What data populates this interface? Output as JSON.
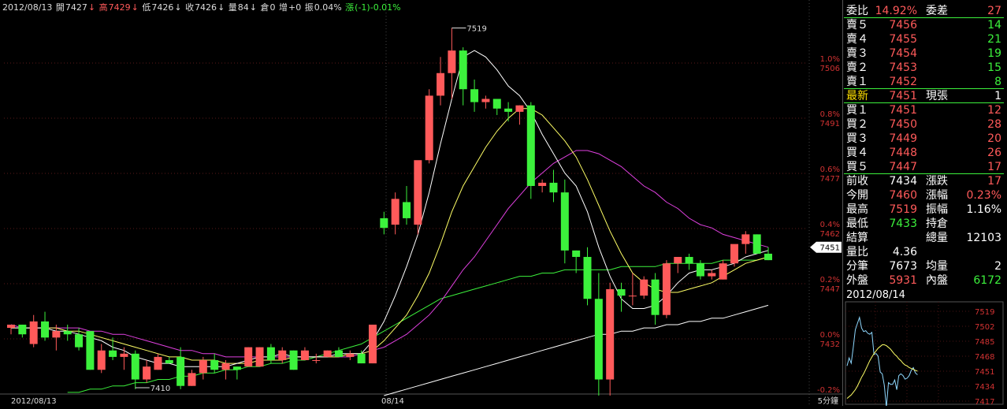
{
  "header": {
    "date": "2012/08/13",
    "open_label": "開",
    "open": "7427",
    "high_label": "高",
    "high": "7429",
    "low_label": "低",
    "low": "7426",
    "close_label": "收",
    "close": "7426",
    "vol_label": "量",
    "vol": "84",
    "oi_label": "倉",
    "oi": "0",
    "add_label": "增",
    "add": "+0",
    "amp_label": "振",
    "amp": "0.04%",
    "chg_label": "漲",
    "chg": "(-1)-0.01%",
    "arrow_down": "↓"
  },
  "chart_data": {
    "type": "candlestick",
    "y_left_labels": [
      "1.0%",
      "0.8%",
      "0.6%",
      "0.4%",
      "0.2%",
      "0.0%",
      "-0.2%"
    ],
    "y_right_labels": [
      "7506",
      "7491",
      "7477",
      "7462",
      "7447",
      "7432"
    ],
    "ylim": [
      7416,
      7530
    ],
    "x_labels": [
      "2012/08/13",
      "08/14"
    ],
    "period_label": "5分鐘",
    "current_price_tag": "7451",
    "high_mark": "7519",
    "low_mark": "7410",
    "colors": {
      "up": "#ff5a5a",
      "down": "#3cf13c",
      "ma5": "#ffffff",
      "ma10": "#ffff66",
      "ma20": "#e040e0",
      "ma60": "#3cf13c",
      "ma120": "#ffffff"
    },
    "candles": [
      [
        7426,
        7427,
        7424,
        7427
      ],
      [
        7427,
        7427,
        7423,
        7424
      ],
      [
        7421,
        7430,
        7420,
        7428
      ],
      [
        7428,
        7431,
        7422,
        7423
      ],
      [
        7423,
        7427,
        7419,
        7425
      ],
      [
        7425,
        7427,
        7422,
        7424
      ],
      [
        7424,
        7426,
        7419,
        7420
      ],
      [
        7425,
        7425,
        7413,
        7413
      ],
      [
        7413,
        7421,
        7412,
        7419
      ],
      [
        7419,
        7423,
        7416,
        7417
      ],
      [
        7417,
        7420,
        7413,
        7418
      ],
      [
        7418,
        7419,
        7407,
        7410
      ],
      [
        7410,
        7416,
        7409,
        7414
      ],
      [
        7413,
        7418,
        7413,
        7417
      ],
      [
        7416,
        7417,
        7415,
        7415
      ],
      [
        7417,
        7420,
        7407,
        7408
      ],
      [
        7408,
        7413,
        7408,
        7412
      ],
      [
        7412,
        7417,
        7410,
        7416
      ],
      [
        7416,
        7418,
        7412,
        7413
      ],
      [
        7413,
        7416,
        7410,
        7415
      ],
      [
        7414,
        7414,
        7410,
        7413
      ],
      [
        7414,
        7420,
        7414,
        7420
      ],
      [
        7414,
        7420,
        7414,
        7420
      ],
      [
        7420,
        7421,
        7415,
        7416
      ],
      [
        7416,
        7420,
        7415,
        7419
      ],
      [
        7419,
        7419,
        7413,
        7413
      ],
      [
        7416,
        7420,
        7416,
        7419
      ],
      [
        7416,
        7418,
        7415,
        7416
      ],
      [
        7417,
        7419,
        7417,
        7419
      ],
      [
        7419,
        7420,
        7417,
        7417
      ],
      [
        7417,
        7419,
        7416,
        7418
      ],
      [
        7418,
        7419,
        7415,
        7415
      ],
      [
        7415,
        7427,
        7415,
        7427
      ],
      [
        7460,
        7462,
        7455,
        7457
      ],
      [
        7458,
        7468,
        7455,
        7466
      ],
      [
        7465,
        7470,
        7458,
        7460
      ],
      [
        7458,
        7475,
        7455,
        7478
      ],
      [
        7478,
        7500,
        7477,
        7498
      ],
      [
        7498,
        7510,
        7495,
        7505
      ],
      [
        7505,
        7519,
        7497,
        7512
      ],
      [
        7512,
        7513,
        7495,
        7500
      ],
      [
        7500,
        7503,
        7493,
        7496
      ],
      [
        7496,
        7498,
        7494,
        7497
      ],
      [
        7497,
        7497,
        7492,
        7494
      ],
      [
        7494,
        7496,
        7490,
        7493
      ],
      [
        7493,
        7495,
        7489,
        7495
      ],
      [
        7495,
        7496,
        7466,
        7470
      ],
      [
        7470,
        7472,
        7468,
        7471
      ],
      [
        7471,
        7475,
        7465,
        7468
      ],
      [
        7468,
        7472,
        7446,
        7450
      ],
      [
        7450,
        7450,
        7443,
        7448
      ],
      [
        7448,
        7451,
        7433,
        7435
      ],
      [
        7435,
        7443,
        7405,
        7410
      ],
      [
        7410,
        7440,
        7405,
        7438
      ],
      [
        7438,
        7440,
        7431,
        7436
      ],
      [
        7436,
        7443,
        7433,
        7436
      ],
      [
        7436,
        7442,
        7435,
        7441
      ],
      [
        7441,
        7443,
        7427,
        7430
      ],
      [
        7430,
        7447,
        7429,
        7446
      ],
      [
        7446,
        7448,
        7443,
        7448
      ],
      [
        7448,
        7449,
        7444,
        7446
      ],
      [
        7446,
        7447,
        7441,
        7442
      ],
      [
        7442,
        7444,
        7441,
        7443
      ],
      [
        7441,
        7447,
        7441,
        7446
      ],
      [
        7446,
        7451,
        7445,
        7452
      ],
      [
        7452,
        7456,
        7449,
        7455
      ],
      [
        7455,
        7455,
        7452,
        7449
      ],
      [
        7449,
        7451,
        7447,
        7447
      ]
    ],
    "ma5": [
      7426,
      7426,
      7426,
      7426,
      7425,
      7425,
      7424,
      7423,
      7422,
      7420,
      7419,
      7417,
      7416,
      7415,
      7415,
      7414,
      7414,
      7414,
      7414,
      7414,
      7415,
      7416,
      7417,
      7417,
      7418,
      7417,
      7417,
      7417,
      7417,
      7418,
      7418,
      7418,
      7422,
      7428,
      7436,
      7445,
      7455,
      7468,
      7483,
      7497,
      7510,
      7512,
      7510,
      7506,
      7501,
      7498,
      7493,
      7486,
      7480,
      7474,
      7470,
      7462,
      7451,
      7442,
      7435,
      7432,
      7432,
      7433,
      7436,
      7440,
      7443,
      7444,
      7444,
      7445,
      7446,
      7448,
      7449,
      7450
    ],
    "ma10": [
      7426,
      7426,
      7426,
      7426,
      7426,
      7425,
      7425,
      7424,
      7423,
      7422,
      7421,
      7420,
      7419,
      7418,
      7417,
      7417,
      7416,
      7416,
      7416,
      7415,
      7415,
      7415,
      7416,
      7416,
      7416,
      7417,
      7417,
      7417,
      7417,
      7417,
      7418,
      7418,
      7419,
      7422,
      7426,
      7430,
      7436,
      7443,
      7452,
      7462,
      7470,
      7476,
      7482,
      7487,
      7491,
      7494,
      7494,
      7492,
      7488,
      7484,
      7479,
      7472,
      7464,
      7456,
      7449,
      7443,
      7440,
      7438,
      7437,
      7437,
      7438,
      7439,
      7440,
      7442,
      7444,
      7446,
      7447,
      7448
    ],
    "ma20": [
      7427,
      7426,
      7426,
      7426,
      7426,
      7426,
      7426,
      7425,
      7425,
      7424,
      7424,
      7423,
      7422,
      7421,
      7420,
      7419,
      7419,
      7418,
      7418,
      7417,
      7417,
      7417,
      7417,
      7417,
      7417,
      7417,
      7417,
      7417,
      7417,
      7417,
      7417,
      7418,
      7419,
      7420,
      7422,
      7424,
      7427,
      7430,
      7434,
      7439,
      7444,
      7448,
      7453,
      7458,
      7463,
      7467,
      7471,
      7474,
      7477,
      7479,
      7481,
      7481,
      7480,
      7478,
      7476,
      7473,
      7470,
      7468,
      7465,
      7463,
      7460,
      7458,
      7457,
      7455,
      7454,
      7453,
      7452,
      7451
    ],
    "ma60": [
      null,
      null,
      null,
      null,
      null,
      7406,
      7406,
      7407,
      7407,
      7408,
      7408,
      7409,
      7409,
      7410,
      7410,
      7411,
      7411,
      7412,
      7412,
      7413,
      7413,
      7414,
      7414,
      7415,
      7415,
      7416,
      7416,
      7417,
      7418,
      7419,
      7420,
      7421,
      7423,
      7425,
      7427,
      7429,
      7431,
      7433,
      7435,
      7436,
      7437,
      7438,
      7439,
      7440,
      7441,
      7442,
      7442,
      7443,
      7443,
      7444,
      7444,
      7444,
      7444,
      7444,
      7445,
      7445,
      7445,
      7445,
      7446,
      7446,
      7446,
      7446,
      7446,
      7447,
      7447,
      7447,
      7447,
      7448
    ],
    "ma120": [
      null,
      null,
      null,
      null,
      null,
      null,
      null,
      null,
      null,
      null,
      null,
      null,
      null,
      null,
      null,
      null,
      null,
      null,
      null,
      null,
      null,
      null,
      null,
      null,
      null,
      null,
      null,
      null,
      null,
      null,
      null,
      null,
      null,
      7405,
      7406,
      7407,
      7408,
      7409,
      7410,
      7411,
      7412,
      7413,
      7414,
      7415,
      7416,
      7417,
      7418,
      7419,
      7420,
      7421,
      7422,
      7423,
      7424,
      7424,
      7425,
      7425,
      7426,
      7426,
      7427,
      7427,
      7428,
      7428,
      7429,
      7429,
      7430,
      7431,
      7432,
      7433
    ]
  },
  "quote": {
    "rows": [
      {
        "l": "委比",
        "v": "14.92%",
        "l2": "委差",
        "v2": "27",
        "vc": "red",
        "v2c": "red"
      },
      {
        "l": "賣５",
        "v": "7456",
        "l2": "",
        "v2": "14",
        "vc": "red",
        "v2c": "grn"
      },
      {
        "l": "賣４",
        "v": "7455",
        "l2": "",
        "v2": "21",
        "vc": "red",
        "v2c": "grn"
      },
      {
        "l": "賣３",
        "v": "7454",
        "l2": "",
        "v2": "19",
        "vc": "red",
        "v2c": "grn"
      },
      {
        "l": "賣２",
        "v": "7453",
        "l2": "",
        "v2": "15",
        "vc": "red",
        "v2c": "grn"
      },
      {
        "l": "賣１",
        "v": "7452",
        "l2": "",
        "v2": "8",
        "vc": "red",
        "v2c": "grn"
      },
      {
        "l": "最新",
        "v": "7451",
        "l2": "現張",
        "v2": "1",
        "vc": "red",
        "v2c": "wht",
        "lc": "yel"
      },
      {
        "l": "買１",
        "v": "7451",
        "l2": "",
        "v2": "12",
        "vc": "red",
        "v2c": "red"
      },
      {
        "l": "買２",
        "v": "7450",
        "l2": "",
        "v2": "28",
        "vc": "red",
        "v2c": "red"
      },
      {
        "l": "買３",
        "v": "7449",
        "l2": "",
        "v2": "20",
        "vc": "red",
        "v2c": "red"
      },
      {
        "l": "買４",
        "v": "7448",
        "l2": "",
        "v2": "26",
        "vc": "red",
        "v2c": "red"
      },
      {
        "l": "買５",
        "v": "7447",
        "l2": "",
        "v2": "17",
        "vc": "red",
        "v2c": "red"
      },
      {
        "l": "前收",
        "v": "7434",
        "l2": "漲跌",
        "v2": "17",
        "vc": "wht",
        "v2c": "red"
      },
      {
        "l": "今開",
        "v": "7460",
        "l2": "漲幅",
        "v2": "0.23%",
        "vc": "red",
        "v2c": "red"
      },
      {
        "l": "最高",
        "v": "7519",
        "l2": "振幅",
        "v2": "1.16%",
        "vc": "red",
        "v2c": "wht"
      },
      {
        "l": "最低",
        "v": "7433",
        "l2": "持倉",
        "v2": "",
        "vc": "grn",
        "v2c": "wht"
      },
      {
        "l": "結算",
        "v": "",
        "l2": "總量",
        "v2": "12103",
        "vc": "wht",
        "v2c": "wht"
      },
      {
        "l": "量比",
        "v": "4.36",
        "l2": "",
        "v2": "",
        "vc": "wht",
        "v2c": "wht"
      },
      {
        "l": "分筆",
        "v": "7673",
        "l2": "均量",
        "v2": "2",
        "vc": "wht",
        "v2c": "wht"
      },
      {
        "l": "外盤",
        "v": "5931",
        "l2": "內盤",
        "v2": "6172",
        "vc": "red",
        "v2c": "grn"
      }
    ]
  },
  "mini": {
    "date": "2012/08/14",
    "y_labels": [
      "7519",
      "7502",
      "7485",
      "7468",
      "7451",
      "7434",
      "7417"
    ]
  }
}
